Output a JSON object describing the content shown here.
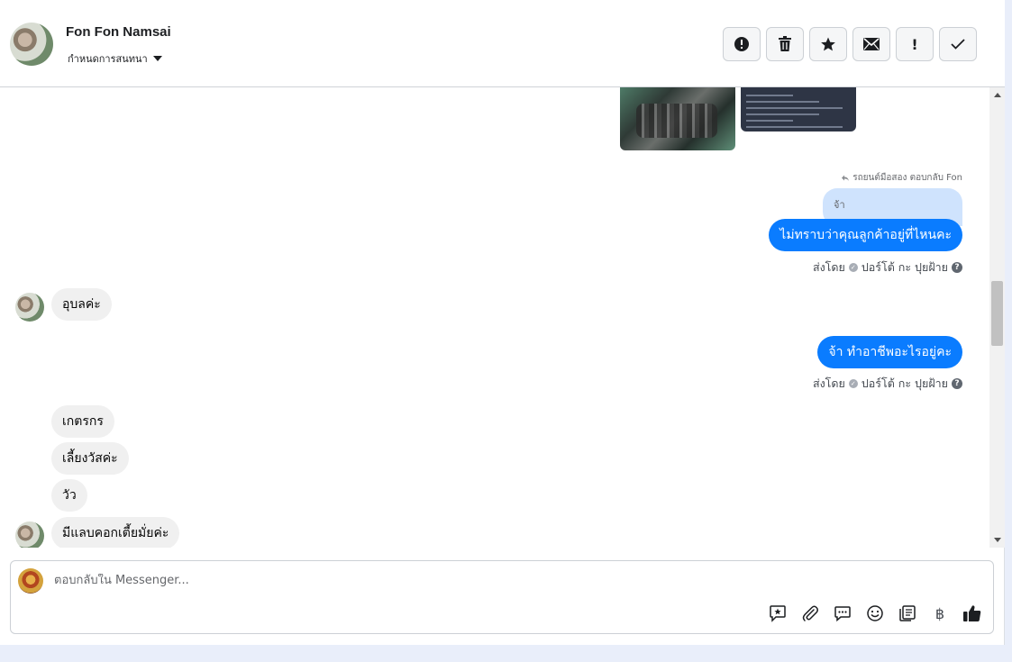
{
  "header": {
    "name": "Fon Fon Namsai",
    "subtitle": "กำหนดการสนทนา",
    "toolbar": [
      {
        "id": "report",
        "icon": "alert-circle-icon"
      },
      {
        "id": "delete",
        "icon": "trash-icon"
      },
      {
        "id": "star",
        "icon": "star-icon"
      },
      {
        "id": "mail",
        "icon": "mail-icon"
      },
      {
        "id": "important",
        "icon": "exclamation-icon",
        "label": "!"
      },
      {
        "id": "done",
        "icon": "check-icon"
      }
    ]
  },
  "conversation": {
    "reply_note": "รถยนต์มือสอง ตอบกลับ Fon",
    "reply_quote": "จ้า",
    "messages": [
      {
        "direction": "out",
        "text": "ไม่ทราบว่าคุณลูกค้าอยู่ที่ไหนคะ",
        "sent_by_label": "ส่งโดย",
        "sender": "ปอร์โต้ กะ ปุยฝ้าย"
      },
      {
        "direction": "in",
        "text": "อุบลค่ะ"
      },
      {
        "direction": "out",
        "text": "จ้า ทำอาชีพอะไรอยู่คะ",
        "sent_by_label": "ส่งโดย",
        "sender": "ปอร์โต้ กะ ปุยฝ้าย"
      },
      {
        "direction": "in",
        "text": "เกตรกร"
      },
      {
        "direction": "in",
        "text": "เลี้ยงวัสค่ะ"
      },
      {
        "direction": "in",
        "text": "วัว"
      },
      {
        "direction": "in",
        "text": "มีแลบคอกเตี้ยมั่ยค่ะ"
      }
    ]
  },
  "composer": {
    "placeholder": "ตอบกลับใน Messenger...",
    "tools": [
      "sticker-icon",
      "paperclip-icon",
      "chat-bubble-icon",
      "emoji-icon",
      "saved-reply-icon",
      "baht-icon",
      "thumbs-up-icon"
    ],
    "baht_symbol": "฿"
  },
  "colors": {
    "outgoing_bubble": "#0a7cff",
    "incoming_bubble": "#f0f0f0",
    "quote_bubble": "#cfe3fd"
  }
}
